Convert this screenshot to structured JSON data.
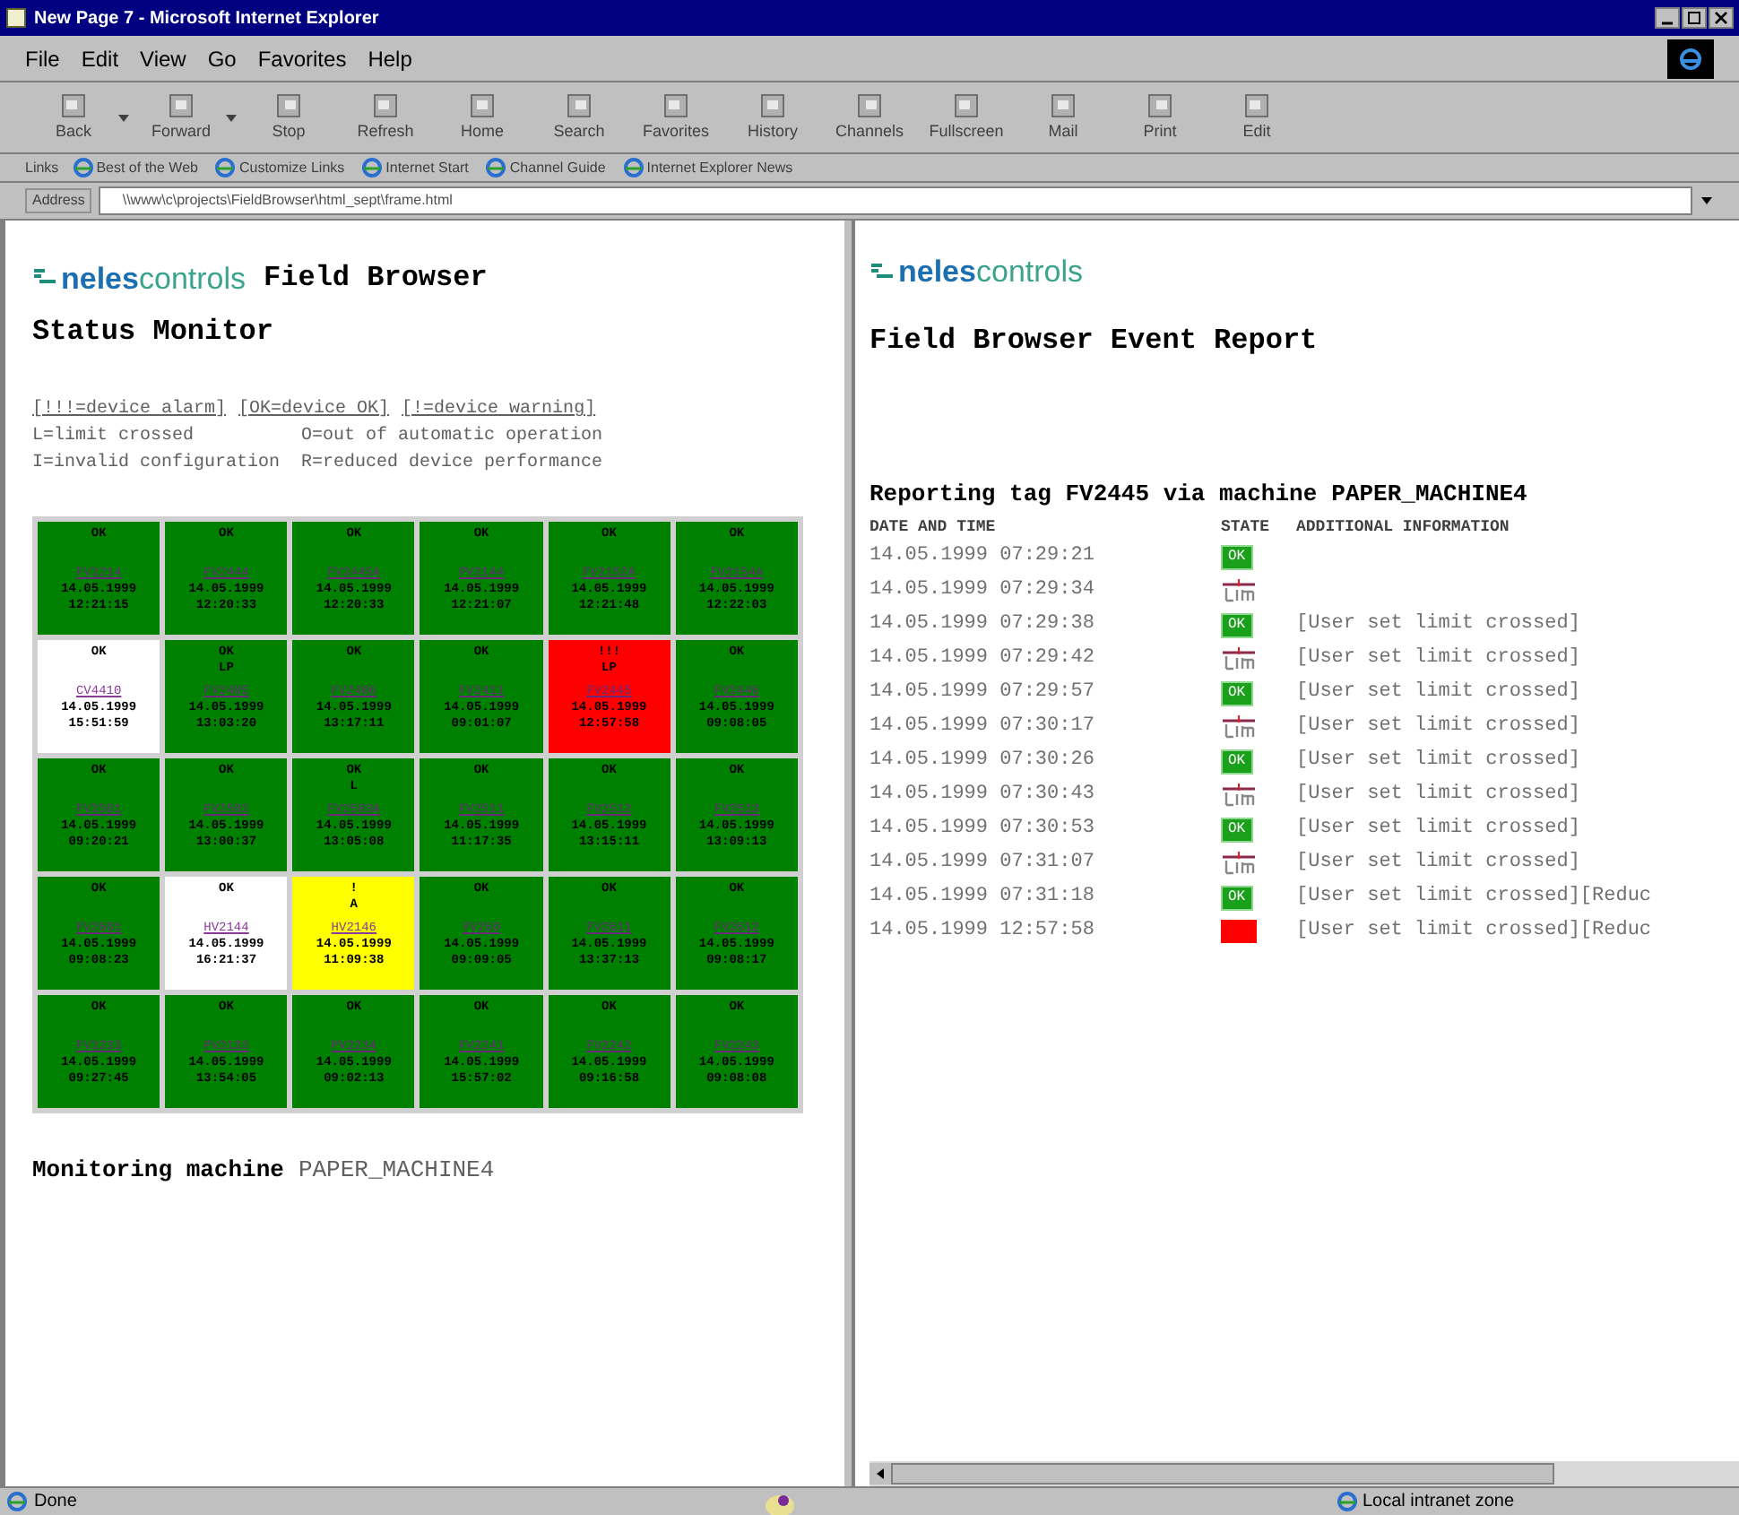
{
  "window": {
    "title": "New Page 7 - Microsoft Internet Explorer"
  },
  "menu": [
    "File",
    "Edit",
    "View",
    "Go",
    "Favorites",
    "Help"
  ],
  "toolbar": [
    {
      "label": "Back",
      "dropdown": true
    },
    {
      "label": "Forward",
      "dropdown": true
    },
    {
      "label": "Stop",
      "dropdown": false
    },
    {
      "label": "Refresh",
      "dropdown": false
    },
    {
      "label": "Home",
      "dropdown": false
    },
    {
      "label": "Search",
      "dropdown": false
    },
    {
      "label": "Favorites",
      "dropdown": false
    },
    {
      "label": "History",
      "dropdown": false
    },
    {
      "label": "Channels",
      "dropdown": false
    },
    {
      "label": "Fullscreen",
      "dropdown": false
    },
    {
      "label": "Mail",
      "dropdown": false
    },
    {
      "label": "Print",
      "dropdown": false
    },
    {
      "label": "Edit",
      "dropdown": false
    }
  ],
  "links": {
    "label": "Links",
    "items": [
      "Best of the Web",
      "Customize Links",
      "Internet Start",
      "Channel Guide",
      "Internet Explorer News"
    ]
  },
  "address": {
    "label": "Address",
    "value": "\\\\www\\c\\projects\\FieldBrowser\\html_sept\\frame.html"
  },
  "left": {
    "logo": {
      "a": "neles",
      "b": "controls"
    },
    "title": "Field Browser",
    "subtitle": "Status Monitor",
    "legend_links": [
      "[!!!=device alarm]",
      "[OK=device OK]",
      "[!=device warning]"
    ],
    "legend": [
      "L=limit crossed          O=out of automatic operation",
      "I=invalid configuration  R=reduced device performance"
    ],
    "grid": [
      [
        {
          "status": "OK",
          "tag": "FV2214",
          "date": "14.05.1999",
          "time": "12:21:15",
          "color": "#008000"
        },
        {
          "status": "OK",
          "tag": "FV2444",
          "date": "14.05.1999",
          "time": "12:20:33",
          "color": "#008000"
        },
        {
          "status": "OK",
          "tag": "FV2445A",
          "date": "14.05.1999",
          "time": "12:20:33",
          "color": "#008000"
        },
        {
          "status": "OK",
          "tag": "PV2144",
          "date": "14.05.1999",
          "time": "12:21:07",
          "color": "#008000"
        },
        {
          "status": "OK",
          "tag": "FV2152A",
          "date": "14.05.1999",
          "time": "12:21:48",
          "color": "#008000"
        },
        {
          "status": "OK",
          "tag": "FV2154A",
          "date": "14.05.1999",
          "time": "12:22:03",
          "color": "#008000"
        }
      ],
      [
        {
          "status": "OK",
          "tag": "CV4410",
          "date": "14.05.1999",
          "time": "15:51:59",
          "color": "#ffffff"
        },
        {
          "status": "OK",
          "flag": "LP",
          "tag": "FV2405",
          "date": "14.05.1999",
          "time": "13:03:20",
          "color": "#008000"
        },
        {
          "status": "OK",
          "tag": "FV2406",
          "date": "14.05.1999",
          "time": "13:17:11",
          "color": "#008000"
        },
        {
          "status": "OK",
          "tag": "FV2411",
          "date": "14.05.1999",
          "time": "09:01:07",
          "color": "#008000"
        },
        {
          "status": "!!!",
          "flag": "LP",
          "tag": "FV2445",
          "date": "14.05.1999",
          "time": "12:57:58",
          "color": "#ff0000"
        },
        {
          "status": "OK",
          "tag": "FV2446",
          "date": "14.05.1999",
          "time": "09:08:05",
          "color": "#008000"
        }
      ],
      [
        {
          "status": "OK",
          "tag": "FV2501",
          "date": "14.05.1999",
          "time": "09:20:21",
          "color": "#008000"
        },
        {
          "status": "OK",
          "tag": "FV2502",
          "date": "14.05.1999",
          "time": "13:00:37",
          "color": "#008000"
        },
        {
          "status": "OK",
          "flag": "L",
          "tag": "FV2503A",
          "date": "14.05.1999",
          "time": "13:05:08",
          "color": "#008000"
        },
        {
          "status": "OK",
          "tag": "FV2511",
          "date": "14.05.1999",
          "time": "11:17:35",
          "color": "#008000"
        },
        {
          "status": "OK",
          "tag": "FV2512",
          "date": "14.05.1999",
          "time": "13:15:11",
          "color": "#008000"
        },
        {
          "status": "OK",
          "tag": "FV2513",
          "date": "14.05.1999",
          "time": "13:09:13",
          "color": "#008000"
        }
      ],
      [
        {
          "status": "OK",
          "tag": "FV2601",
          "date": "14.05.1999",
          "time": "09:08:23",
          "color": "#008000"
        },
        {
          "status": "OK",
          "tag": "HV2144",
          "date": "14.05.1999",
          "time": "16:21:37",
          "color": "#ffffff"
        },
        {
          "status": "!",
          "flag": "A",
          "tag": "HV2146",
          "date": "14.05.1999",
          "time": "11:09:38",
          "color": "#ffff00"
        },
        {
          "status": "OK",
          "tag": "FV260",
          "date": "14.05.1999",
          "time": "09:09:05",
          "color": "#008000"
        },
        {
          "status": "OK",
          "tag": "FV2611",
          "date": "14.05.1999",
          "time": "13:37:13",
          "color": "#008000"
        },
        {
          "status": "OK",
          "tag": "FV2612",
          "date": "14.05.1999",
          "time": "09:08:17",
          "color": "#008000"
        }
      ],
      [
        {
          "status": "OK",
          "tag": "FV2233",
          "date": "14.05.1999",
          "time": "09:27:45",
          "color": "#008000"
        },
        {
          "status": "OK",
          "tag": "PV2133",
          "date": "14.05.1999",
          "time": "13:54:05",
          "color": "#008000"
        },
        {
          "status": "OK",
          "tag": "PV2234",
          "date": "14.05.1999",
          "time": "09:02:13",
          "color": "#008000"
        },
        {
          "status": "OK",
          "tag": "FV2241",
          "date": "14.05.1999",
          "time": "15:57:02",
          "color": "#008000"
        },
        {
          "status": "OK",
          "tag": "FV2242",
          "date": "14.05.1999",
          "time": "09:16:58",
          "color": "#008000"
        },
        {
          "status": "OK",
          "tag": "FV2243",
          "date": "14.05.1999",
          "time": "09:08:08",
          "color": "#008000"
        }
      ]
    ],
    "monitoring": {
      "label": "Monitoring machine",
      "machine": "PAPER_MACHINE4"
    }
  },
  "right": {
    "logo": {
      "a": "neles",
      "b": "controls"
    },
    "title": "Field Browser Event Report",
    "reporting": {
      "label": "Reporting tag FV2445 via machine",
      "machine": "PAPER_MACHINE4"
    },
    "columns": [
      "DATE AND TIME",
      "STATE",
      "ADDITIONAL INFORMATION"
    ],
    "rows": [
      {
        "time": "14.05.1999 07:29:21",
        "kind": "ok",
        "label": "OK"
      },
      {
        "time": "14.05.1999 07:29:34",
        "kind": "limit"
      },
      {
        "time": "14.05.1999 07:29:38",
        "kind": "ok",
        "label": "OK",
        "info": "[User set limit crossed]"
      },
      {
        "time": "14.05.1999 07:29:42",
        "kind": "limit",
        "info": "[User set limit crossed]"
      },
      {
        "time": "14.05.1999 07:29:57",
        "kind": "ok",
        "label": "OK",
        "info": "[User set limit crossed]"
      },
      {
        "time": "14.05.1999 07:30:17",
        "kind": "limit",
        "info": "[User set limit crossed]"
      },
      {
        "time": "14.05.1999 07:30:26",
        "kind": "ok",
        "label": "OK",
        "info": "[User set limit crossed]"
      },
      {
        "time": "14.05.1999 07:30:43",
        "kind": "limit",
        "info": "[User set limit crossed]"
      },
      {
        "time": "14.05.1999 07:30:53",
        "kind": "ok",
        "label": "OK",
        "info": "[User set limit crossed]"
      },
      {
        "time": "14.05.1999 07:31:07",
        "kind": "limit",
        "info": "[User set limit crossed]"
      },
      {
        "time": "14.05.1999 07:31:18",
        "kind": "ok",
        "label": "OK",
        "info": "[User set limit crossed][Reduc"
      },
      {
        "time": "14.05.1999 12:57:58",
        "kind": "alarm",
        "info": "[User set limit crossed][Reduc"
      }
    ]
  },
  "status_bar": {
    "text": "Done",
    "zone": "Local intranet zone"
  }
}
